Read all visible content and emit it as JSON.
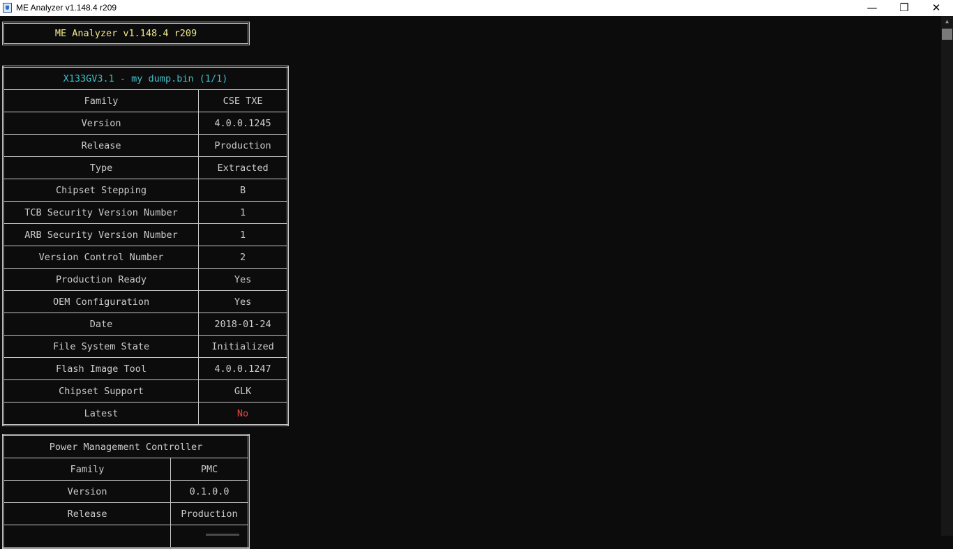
{
  "window": {
    "title": "ME Analyzer v1.148.4 r209",
    "icons": {
      "app": "shield-app-icon",
      "minimize": "minimize-icon",
      "maximize": "restore-icon",
      "close": "close-icon"
    },
    "buttons": {
      "minimize": "—",
      "maximize": "❐",
      "close": "✕"
    }
  },
  "banner": "ME Analyzer v1.148.4 r209",
  "me_table": {
    "header": "X133GV3.1 - my dump.bin (1/1)",
    "rows": [
      {
        "label": "Family",
        "value": "CSE TXE"
      },
      {
        "label": "Version",
        "value": "4.0.0.1245"
      },
      {
        "label": "Release",
        "value": "Production"
      },
      {
        "label": "Type",
        "value": "Extracted"
      },
      {
        "label": "Chipset Stepping",
        "value": "B"
      },
      {
        "label": "TCB Security Version Number",
        "value": "1"
      },
      {
        "label": "ARB Security Version Number",
        "value": "1"
      },
      {
        "label": "Version Control Number",
        "value": "2"
      },
      {
        "label": "Production Ready",
        "value": "Yes"
      },
      {
        "label": "OEM Configuration",
        "value": "Yes"
      },
      {
        "label": "Date",
        "value": "2018-01-24"
      },
      {
        "label": "File System State",
        "value": "Initialized"
      },
      {
        "label": "Flash Image Tool",
        "value": "4.0.0.1247"
      },
      {
        "label": "Chipset Support",
        "value": "GLK"
      },
      {
        "label": "Latest",
        "value": "No"
      }
    ]
  },
  "pmc_table": {
    "header": "Power Management Controller",
    "rows": [
      {
        "label": "Family",
        "value": "PMC"
      },
      {
        "label": "Version",
        "value": "0.1.0.0"
      },
      {
        "label": "Release",
        "value": "Production"
      },
      {
        "label": "",
        "value": ""
      }
    ]
  },
  "scrollbar": {
    "up_glyph": "▲"
  },
  "colors": {
    "background": "#0c0c0c",
    "text": "#cccccc",
    "banner": "#f0e88a",
    "header": "#3fc0c8",
    "alert": "#e8423f"
  }
}
